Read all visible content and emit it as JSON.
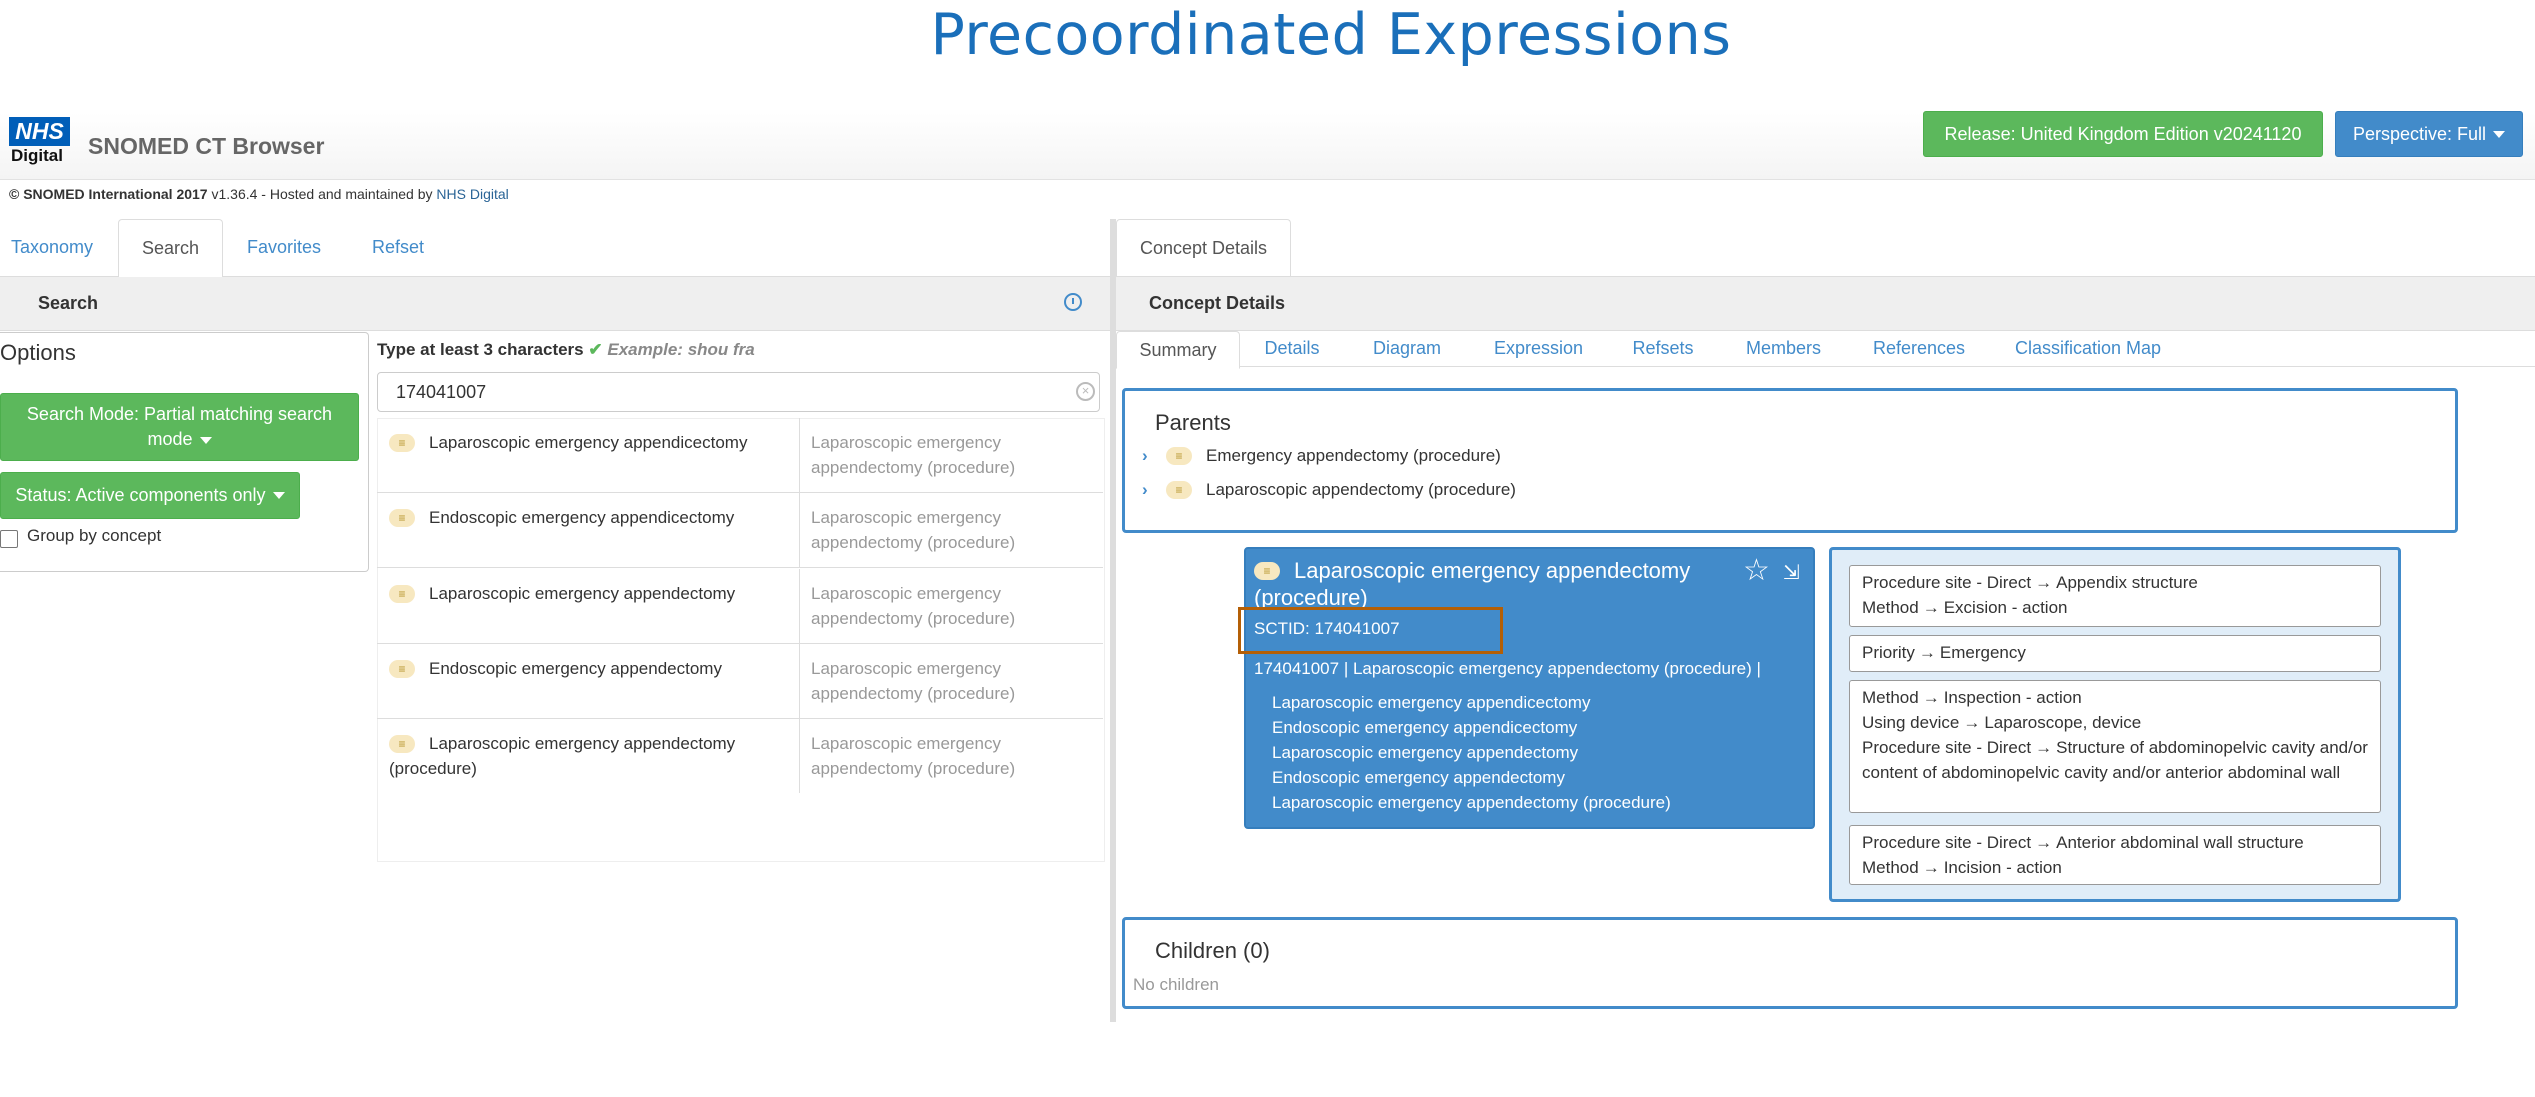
{
  "slide_title": "Precoordinated Expressions",
  "logo": {
    "text": "NHS",
    "subtext": "Digital"
  },
  "brand": "SNOMED CT Browser",
  "release_button": "Release: United Kingdom Edition v20241120",
  "perspective_button": "Perspective: Full",
  "copyright": {
    "prefix": "© SNOMED International 2017",
    "middle": " v1.36.4 - Hosted and maintained by ",
    "link": "NHS Digital"
  },
  "left_tabs": [
    "Taxonomy",
    "Search",
    "Favorites",
    "Refset"
  ],
  "search_header": "Search",
  "options": {
    "title": "Options",
    "search_mode": "Search Mode: Partial matching search mode",
    "status": "Status: Active components only",
    "group_by": "Group by concept"
  },
  "hint": {
    "bold": "Type at least 3 characters",
    "check": "✔",
    "example_label": "Example:",
    "example": "shou fra"
  },
  "search": {
    "value": "174041007"
  },
  "results": [
    {
      "term": "Laparoscopic emergency appendicectomy",
      "fsn": "Laparoscopic emergency appendectomy (procedure)"
    },
    {
      "term": "Endoscopic emergency appendicectomy",
      "fsn": "Laparoscopic emergency appendectomy (procedure)"
    },
    {
      "term": "Laparoscopic emergency appendectomy",
      "fsn": "Laparoscopic emergency appendectomy (procedure)"
    },
    {
      "term": "Endoscopic emergency appendectomy",
      "fsn": "Laparoscopic emergency appendectomy (procedure)"
    },
    {
      "term": "Laparoscopic emergency appendectomy (procedure)",
      "fsn": "Laparoscopic emergency appendectomy (procedure)"
    }
  ],
  "right_tab": "Concept Details",
  "concept_header": "Concept Details",
  "summary_tabs": [
    "Summary",
    "Details",
    "Diagram",
    "Expression",
    "Refsets",
    "Members",
    "References",
    "Classification Map"
  ],
  "parents": {
    "title": "Parents",
    "items": [
      "Emergency appendectomy (procedure)",
      "Laparoscopic appendectomy (procedure)"
    ]
  },
  "concept": {
    "title": "Laparoscopic emergency appendectomy (procedure)",
    "sctid": "SCTID: 174041007",
    "id_line": "174041007 | Laparoscopic emergency appendectomy (procedure) |",
    "synonyms": [
      "Laparoscopic emergency appendicectomy",
      "Endoscopic emergency appendicectomy",
      "Laparoscopic emergency appendectomy",
      "Endoscopic emergency appendectomy",
      "Laparoscopic emergency appendectomy (procedure)"
    ]
  },
  "attributes": {
    "group1": [
      {
        "type": "Procedure site - Direct",
        "value": "Appendix structure"
      },
      {
        "type": "Method",
        "value": "Excision - action"
      }
    ],
    "group2": [
      {
        "type": "Priority",
        "value": "Emergency"
      }
    ],
    "group3": [
      {
        "type": "Method",
        "value": "Inspection - action"
      },
      {
        "type": "Using device",
        "value": "Laparoscope, device"
      },
      {
        "type": "Procedure site - Direct",
        "value": "Structure of abdominopelvic cavity and/or content of abdominopelvic cavity and/or anterior abdominal wall"
      }
    ],
    "group4": [
      {
        "type": "Procedure site - Direct",
        "value": "Anterior abdominal wall structure"
      },
      {
        "type": "Method",
        "value": "Incision - action"
      }
    ],
    "arrow": "→"
  },
  "children": {
    "title": "Children (0)",
    "empty": "No children"
  },
  "icons": {
    "pill": "≡",
    "chevron": "›",
    "star": "☆",
    "export": "⇲",
    "clear": "×"
  },
  "colors": {
    "primary": "#428bca",
    "success": "#5cb85c",
    "title": "#1a6fba",
    "highlight": "#b45f06"
  }
}
